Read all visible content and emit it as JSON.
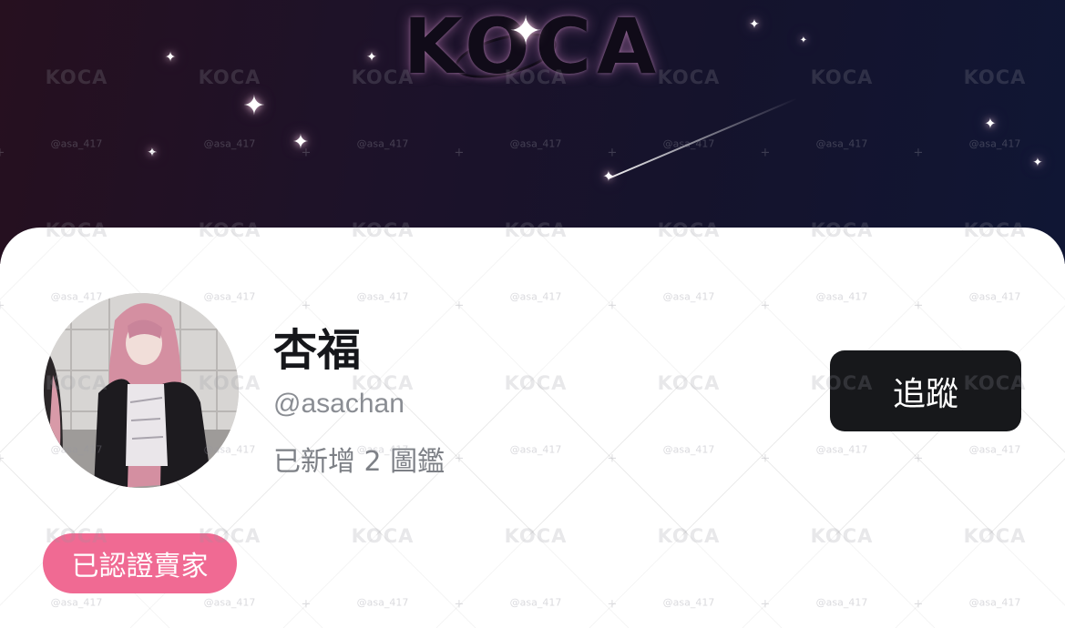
{
  "banner": {
    "logo_text": "KOCA",
    "watermark_logo": "KOCA",
    "watermark_handle": "@asa_417"
  },
  "profile": {
    "name": "杏福",
    "handle": "@asachan",
    "stats_text": "已新增 2 圖鑑",
    "badge_label": "已認證賣家",
    "avatar_icon": "profile-photo"
  },
  "actions": {
    "follow_label": "追蹤"
  },
  "colors": {
    "follow_button": "#17181b",
    "badge": "#f06a93",
    "name_text": "#16171b",
    "secondary_text": "#8a8d93"
  }
}
